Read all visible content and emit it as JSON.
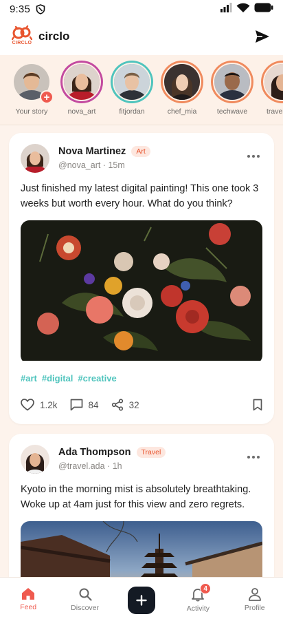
{
  "status_bar": {
    "time": "9:35"
  },
  "app": {
    "logo_text": "CIRCLO",
    "title": "circlo"
  },
  "stories": [
    {
      "label": "Your story",
      "ring_color": "#fdf1e8",
      "is_own": true,
      "add_symbol": "+"
    },
    {
      "label": "nova_art",
      "ring_color": "#c34aa0"
    },
    {
      "label": "fitjordan",
      "ring_color": "#4fc4bd"
    },
    {
      "label": "chef_mia",
      "ring_color": "#f08a5d"
    },
    {
      "label": "techwave",
      "ring_color": "#f08a5d"
    },
    {
      "label": "travel.ada",
      "ring_color": "#f08a5d"
    }
  ],
  "posts": [
    {
      "name": "Nova Martinez",
      "category": "Art",
      "handle": "@nova_art · 15m",
      "text": "Just finished my latest digital painting! This one took 3 weeks but worth every hour. What do you think?",
      "hashtags": [
        "#art",
        "#digital",
        "#creative"
      ],
      "likes": "1.2k",
      "comments": "84",
      "shares": "32"
    },
    {
      "name": "Ada Thompson",
      "category": "Travel",
      "handle": "@travel.ada · 1h",
      "text": "Kyoto in the morning mist is absolutely breathtaking. Woke up at 4am just for this view and zero regrets."
    }
  ],
  "nav": {
    "items": [
      {
        "label": "Feed",
        "icon": "home-icon",
        "active": true
      },
      {
        "label": "Discover",
        "icon": "search-icon"
      },
      {
        "label": "",
        "icon": "plus-icon"
      },
      {
        "label": "Activity",
        "icon": "bell-icon",
        "badge": "4"
      },
      {
        "label": "Profile",
        "icon": "person-icon"
      }
    ]
  },
  "colors": {
    "accent": "#ef5a4f",
    "hashtag": "#4fc4bd",
    "background": "#fdf3ec"
  }
}
